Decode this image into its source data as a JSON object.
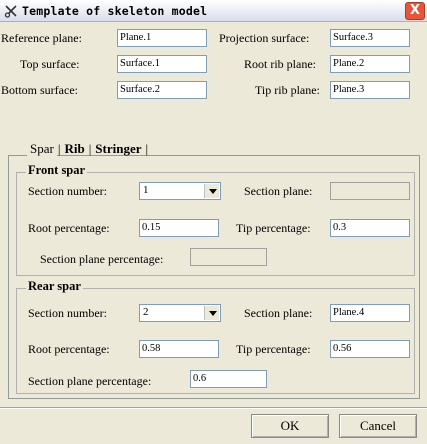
{
  "window": {
    "title": "Template of skeleton model",
    "close_glyph": "X",
    "icon": "tool-scissors-icon"
  },
  "top_form": {
    "reference_plane": {
      "label": "Reference plane:",
      "value": "Plane.1"
    },
    "projection_surface": {
      "label": "Projection surface:",
      "value": "Surface.3"
    },
    "top_surface": {
      "label": "Top surface:",
      "value": "Surface.1"
    },
    "root_rib_plane": {
      "label": "Root rib plane:",
      "value": "Plane.2"
    },
    "bottom_surface": {
      "label": "Bottom surface:",
      "value": "Surface.2"
    },
    "tip_rib_plane": {
      "label": "Tip rib plane:",
      "value": "Plane.3"
    }
  },
  "tabs": [
    {
      "label": "Spar",
      "active": true
    },
    {
      "label": "Rib",
      "active": false
    },
    {
      "label": "Stringer",
      "active": false
    }
  ],
  "tab_separator": "|",
  "front_spar": {
    "title": "Front spar",
    "section_number": {
      "label": "Section number:",
      "value": "1"
    },
    "section_plane": {
      "label": "Section plane:",
      "value": ""
    },
    "root_percentage": {
      "label": "Root percentage:",
      "value": "0.15"
    },
    "tip_percentage": {
      "label": "Tip percentage:",
      "value": "0.3"
    },
    "section_plane_percentage": {
      "label": "Section plane percentage:",
      "value": ""
    }
  },
  "rear_spar": {
    "title": "Rear spar",
    "section_number": {
      "label": "Section number:",
      "value": "2"
    },
    "section_plane": {
      "label": "Section plane:",
      "value": "Plane.4"
    },
    "root_percentage": {
      "label": "Root percentage:",
      "value": "0.58"
    },
    "tip_percentage": {
      "label": "Tip percentage:",
      "value": "0.56"
    },
    "section_plane_percentage": {
      "label": "Section plane percentage:",
      "value": "0.6"
    }
  },
  "buttons": {
    "ok": "OK",
    "cancel": "Cancel"
  }
}
